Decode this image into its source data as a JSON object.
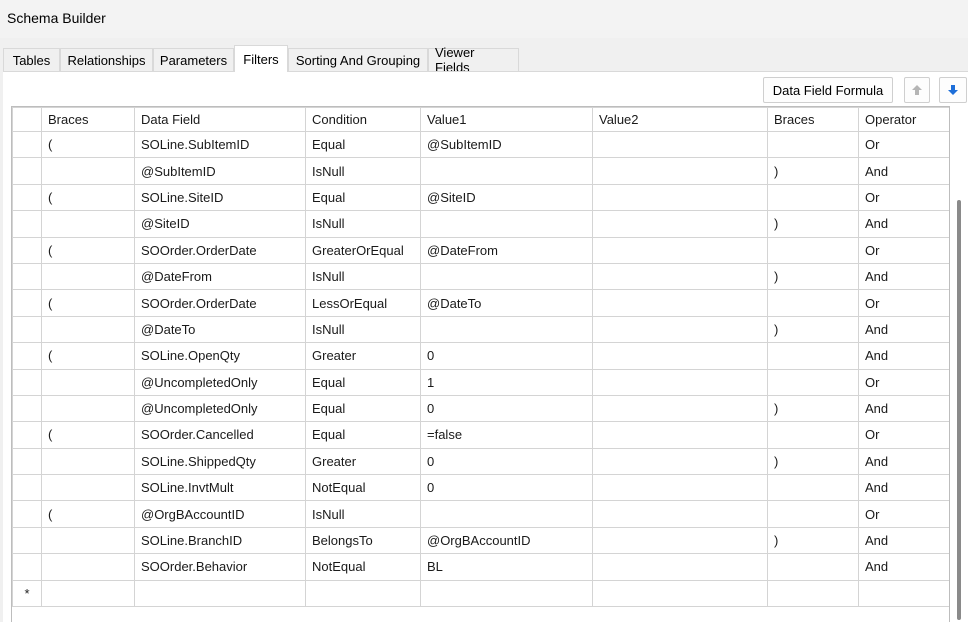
{
  "window": {
    "title": "Schema Builder"
  },
  "tabs": [
    {
      "label": "Tables",
      "active": false
    },
    {
      "label": "Relationships",
      "active": false
    },
    {
      "label": "Parameters",
      "active": false
    },
    {
      "label": "Filters",
      "active": true
    },
    {
      "label": "Sorting And Grouping",
      "active": false
    },
    {
      "label": "Viewer Fields",
      "active": false
    }
  ],
  "toolbar": {
    "data_field_formula_label": "Data Field Formula",
    "move_up_icon": "arrow-up-icon",
    "move_down_icon": "arrow-down-icon",
    "accent_color": "#1e6fd9"
  },
  "grid": {
    "columns": [
      "Braces",
      "Data Field",
      "Condition",
      "Value1",
      "Value2",
      "Braces",
      "Operator"
    ],
    "rows": [
      [
        "(",
        "SOLine.SubItemID",
        "Equal",
        "@SubItemID",
        "",
        "",
        "Or"
      ],
      [
        "",
        "@SubItemID",
        "IsNull",
        "",
        "",
        ")",
        "And"
      ],
      [
        "(",
        "SOLine.SiteID",
        "Equal",
        "@SiteID",
        "",
        "",
        "Or"
      ],
      [
        "",
        "@SiteID",
        "IsNull",
        "",
        "",
        ")",
        "And"
      ],
      [
        "(",
        "SOOrder.OrderDate",
        "GreaterOrEqual",
        "@DateFrom",
        "",
        "",
        "Or"
      ],
      [
        "",
        "@DateFrom",
        "IsNull",
        "",
        "",
        ")",
        "And"
      ],
      [
        "(",
        "SOOrder.OrderDate",
        "LessOrEqual",
        "@DateTo",
        "",
        "",
        "Or"
      ],
      [
        "",
        "@DateTo",
        "IsNull",
        "",
        "",
        ")",
        "And"
      ],
      [
        "(",
        "SOLine.OpenQty",
        "Greater",
        "0",
        "",
        "",
        "And"
      ],
      [
        "",
        "@UncompletedOnly",
        "Equal",
        "1",
        "",
        "",
        "Or"
      ],
      [
        "",
        "@UncompletedOnly",
        "Equal",
        "0",
        "",
        ")",
        "And"
      ],
      [
        "(",
        "SOOrder.Cancelled",
        "Equal",
        "=false",
        "",
        "",
        "Or"
      ],
      [
        "",
        "SOLine.ShippedQty",
        "Greater",
        "0",
        "",
        ")",
        "And"
      ],
      [
        "",
        "SOLine.InvtMult",
        "NotEqual",
        "0",
        "",
        "",
        "And"
      ],
      [
        "(",
        "@OrgBAccountID",
        "IsNull",
        "",
        "",
        "",
        "Or"
      ],
      [
        "",
        "SOLine.BranchID",
        "BelongsTo",
        "@OrgBAccountID",
        "",
        ")",
        "And"
      ],
      [
        "",
        "SOOrder.Behavior",
        "NotEqual",
        "BL",
        "",
        "",
        "And"
      ]
    ],
    "new_row_marker": "*"
  }
}
